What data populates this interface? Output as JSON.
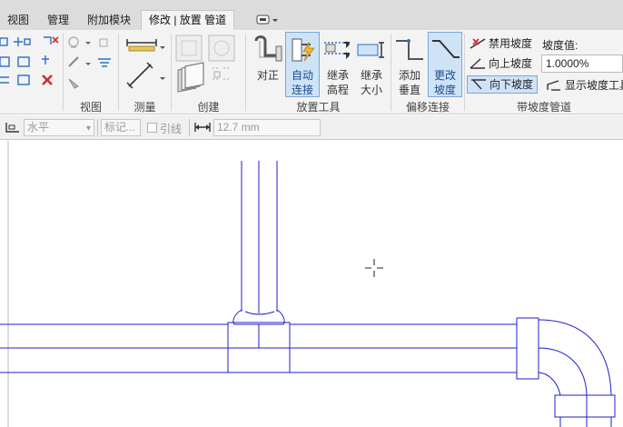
{
  "tabs": [
    {
      "label": "视图",
      "active": false
    },
    {
      "label": "管理",
      "active": false
    },
    {
      "label": "附加模块",
      "active": false
    },
    {
      "label": "修改 | 放置 管道",
      "active": true
    }
  ],
  "ribbon": {
    "panels": {
      "view": "视图",
      "measure": "测量",
      "create": "创建",
      "placement_tools": "放置工具",
      "offset_connections": "偏移连接",
      "sloped_piping": "带坡度管道"
    },
    "buttons": {
      "justify": "对正",
      "auto_connect_1": "自动",
      "auto_connect_2": "连接",
      "inherit_elev_1": "继承",
      "inherit_elev_2": "高程",
      "inherit_size_1": "继承",
      "inherit_size_2": "大小",
      "add_vertical_1": "添加",
      "add_vertical_2": "垂直",
      "change_slope_1": "更改",
      "change_slope_2": "坡度"
    },
    "slope": {
      "disable": "禁用坡度",
      "up": "向上坡度",
      "down": "向下坡度",
      "value_label": "坡度值:",
      "value": "1.0000%",
      "show_tooltip": "显示坡度工具"
    }
  },
  "options_bar": {
    "placement_plane": "水平",
    "tag_button": "标记...",
    "leader_label": "引线",
    "leader_checked": false,
    "length_value": "12.7 mm"
  },
  "colors": {
    "pipe": "#1f1fcc",
    "selection": "#cfe3f7",
    "accent": "#1a6fd1"
  }
}
